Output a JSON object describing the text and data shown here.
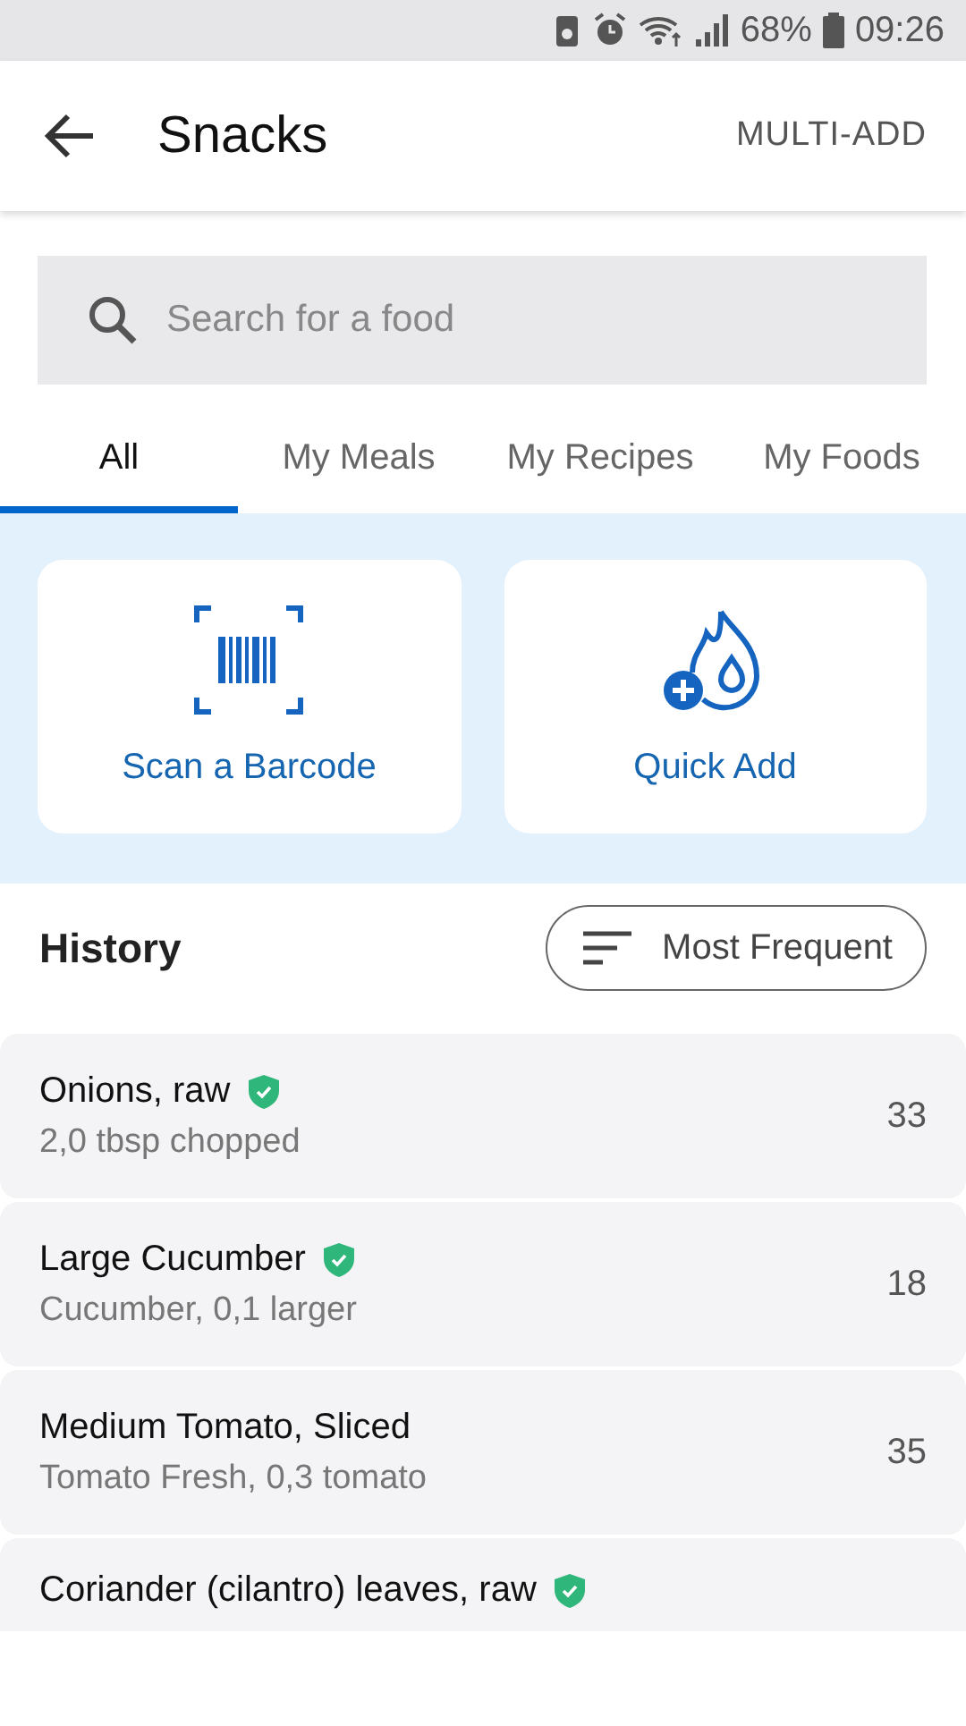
{
  "status_bar": {
    "battery": "68%",
    "time": "09:26"
  },
  "app_bar": {
    "title": "Snacks",
    "action": "MULTI-ADD"
  },
  "search": {
    "placeholder": "Search for a food"
  },
  "tabs": [
    {
      "label": "All",
      "selected": true
    },
    {
      "label": "My Meals",
      "selected": false
    },
    {
      "label": "My Recipes",
      "selected": false
    },
    {
      "label": "My Foods",
      "selected": false
    }
  ],
  "quick_actions": [
    {
      "kind": "barcode",
      "label": "Scan a Barcode"
    },
    {
      "kind": "quick-add",
      "label": "Quick Add"
    }
  ],
  "history": {
    "title": "History",
    "sort": "Most Frequent",
    "items": [
      {
        "name": "Onions, raw",
        "verified": true,
        "detail": "2,0 tbsp chopped",
        "count": "33"
      },
      {
        "name": "Large Cucumber",
        "verified": true,
        "detail": "Cucumber, 0,1 larger",
        "count": "18"
      },
      {
        "name": "Medium Tomato, Sliced",
        "verified": false,
        "detail": "Tomato Fresh, 0,3 tomato",
        "count": "35"
      },
      {
        "name": "Coriander (cilantro) leaves, raw",
        "verified": true
      }
    ]
  }
}
